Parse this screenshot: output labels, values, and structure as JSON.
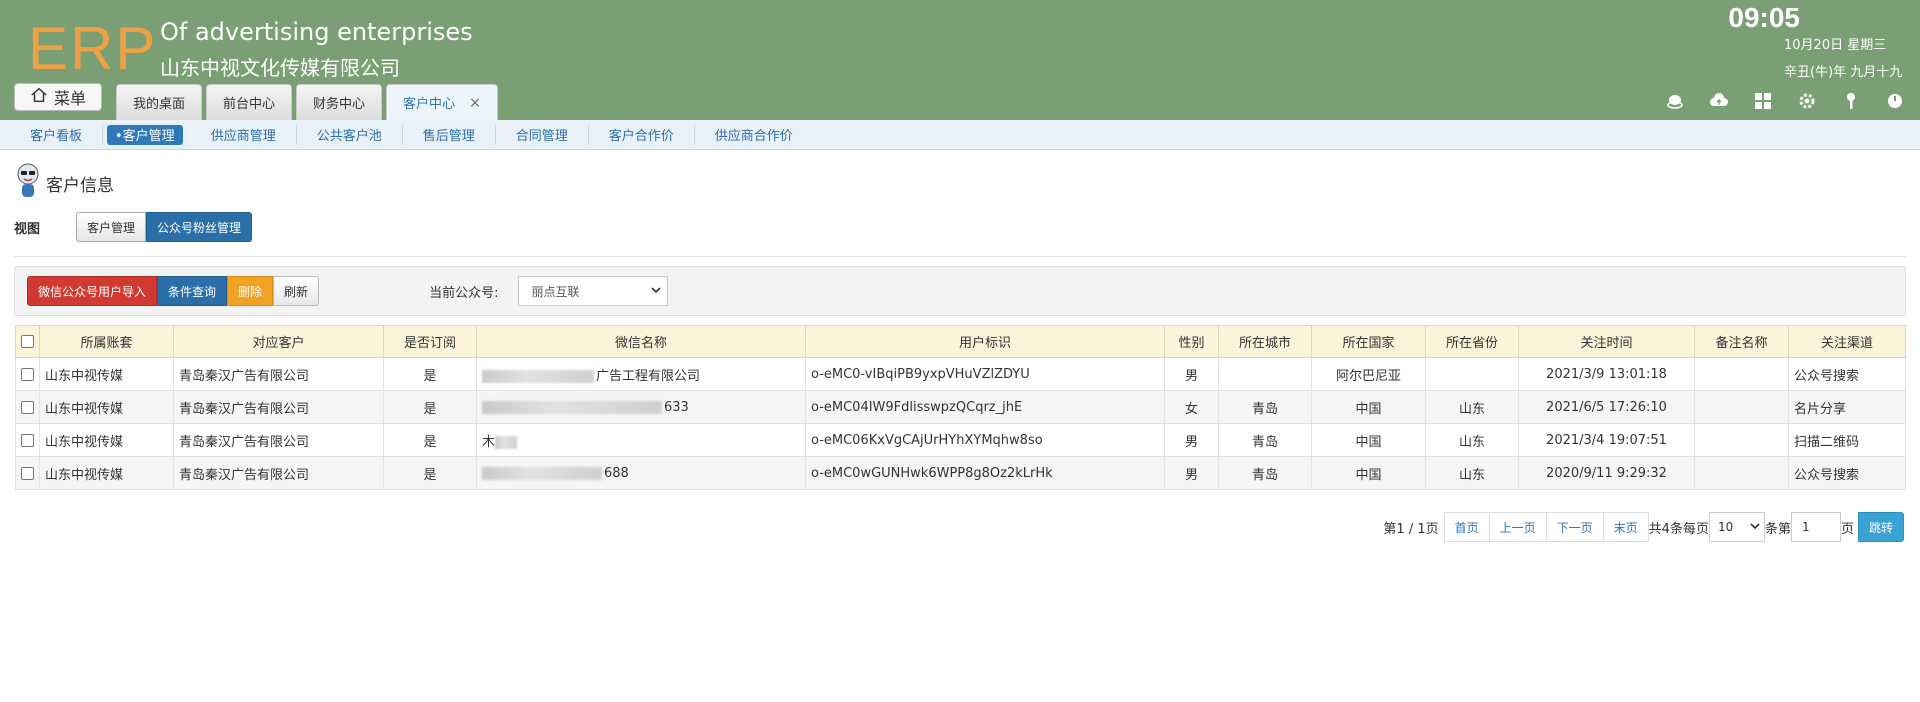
{
  "header": {
    "logo": "ERP",
    "company_en": "Of advertising enterprises",
    "company_cn": "山东中视文化传媒有限公司",
    "time": "09:05",
    "date": "10月20日 星期三",
    "lunar": "辛丑(牛)年 九月十九",
    "menu_label": "菜单",
    "background_color": "#7a9f74",
    "logo_color": "#f0a044"
  },
  "tabs": [
    {
      "label": "我的桌面"
    },
    {
      "label": "前台中心"
    },
    {
      "label": "财务中心"
    },
    {
      "label": "客户中心",
      "close": "×"
    }
  ],
  "header_icons": [
    "coin-icon",
    "cloud-icon",
    "grid-icon",
    "gear-icon",
    "key-icon",
    "power-icon"
  ],
  "subnav": [
    "客户看板",
    "•客户管理",
    "供应商管理",
    "公共客户池",
    "售后管理",
    "合同管理",
    "客户合作价",
    "供应商合作价"
  ],
  "page": {
    "title": "客户信息",
    "view_label": "视图",
    "view_buttons": [
      "客户管理",
      "公众号粉丝管理"
    ]
  },
  "toolbar": {
    "import_label": "微信公众号用户导入",
    "query_label": "条件查询",
    "delete_label": "删除",
    "refresh_label": "刷新",
    "account_label": "当前公众号:",
    "account_value": "丽点互联"
  },
  "table": {
    "columns": [
      "所属账套",
      "对应客户",
      "是否订阅",
      "微信名称",
      "用户标识",
      "性别",
      "所在城市",
      "所在国家",
      "所在省份",
      "关注时间",
      "备注名称",
      "关注渠道"
    ],
    "rows": [
      {
        "account": "山东中视传媒",
        "customer": "青岛秦汉广告有限公司",
        "subscribed": "是",
        "wechat_name": "广告工程有限公司",
        "openid": "o-eMC0-vIBqiPB9yxpVHuVZlZDYU",
        "gender": "男",
        "city": "",
        "country": "阿尔巴尼亚",
        "province": "",
        "follow_time": "2021/3/9 13:01:18",
        "remark": "",
        "channel": "公众号搜索"
      },
      {
        "account": "山东中视传媒",
        "customer": "青岛秦汉广告有限公司",
        "subscribed": "是",
        "wechat_name": "633",
        "openid": "o-eMC04IW9FdlisswpzQCqrz_jhE",
        "gender": "女",
        "city": "青岛",
        "country": "中国",
        "province": "山东",
        "follow_time": "2021/6/5 17:26:10",
        "remark": "",
        "channel": "名片分享"
      },
      {
        "account": "山东中视传媒",
        "customer": "青岛秦汉广告有限公司",
        "subscribed": "是",
        "wechat_name": "木",
        "openid": "o-eMC06KxVgCAjUrHYhXYMqhw8so",
        "gender": "男",
        "city": "青岛",
        "country": "中国",
        "province": "山东",
        "follow_time": "2021/3/4 19:07:51",
        "remark": "",
        "channel": "扫描二维码"
      },
      {
        "account": "山东中视传媒",
        "customer": "青岛秦汉广告有限公司",
        "subscribed": "是",
        "wechat_name": "688",
        "openid": "o-eMC0wGUNHwk6WPP8g8Oz2kLrHk",
        "gender": "男",
        "city": "青岛",
        "country": "中国",
        "province": "山东",
        "follow_time": "2020/9/11 9:29:32",
        "remark": "",
        "channel": "公众号搜索"
      }
    ]
  },
  "pager": {
    "page_info": "第1 / 1页",
    "first": "首页",
    "prev": "上一页",
    "next": "下一页",
    "last": "末页",
    "total_info": "共4条每页",
    "page_size": "10",
    "unit": "条第",
    "page_input": "1",
    "page_suffix": "页",
    "go": "跳转"
  }
}
